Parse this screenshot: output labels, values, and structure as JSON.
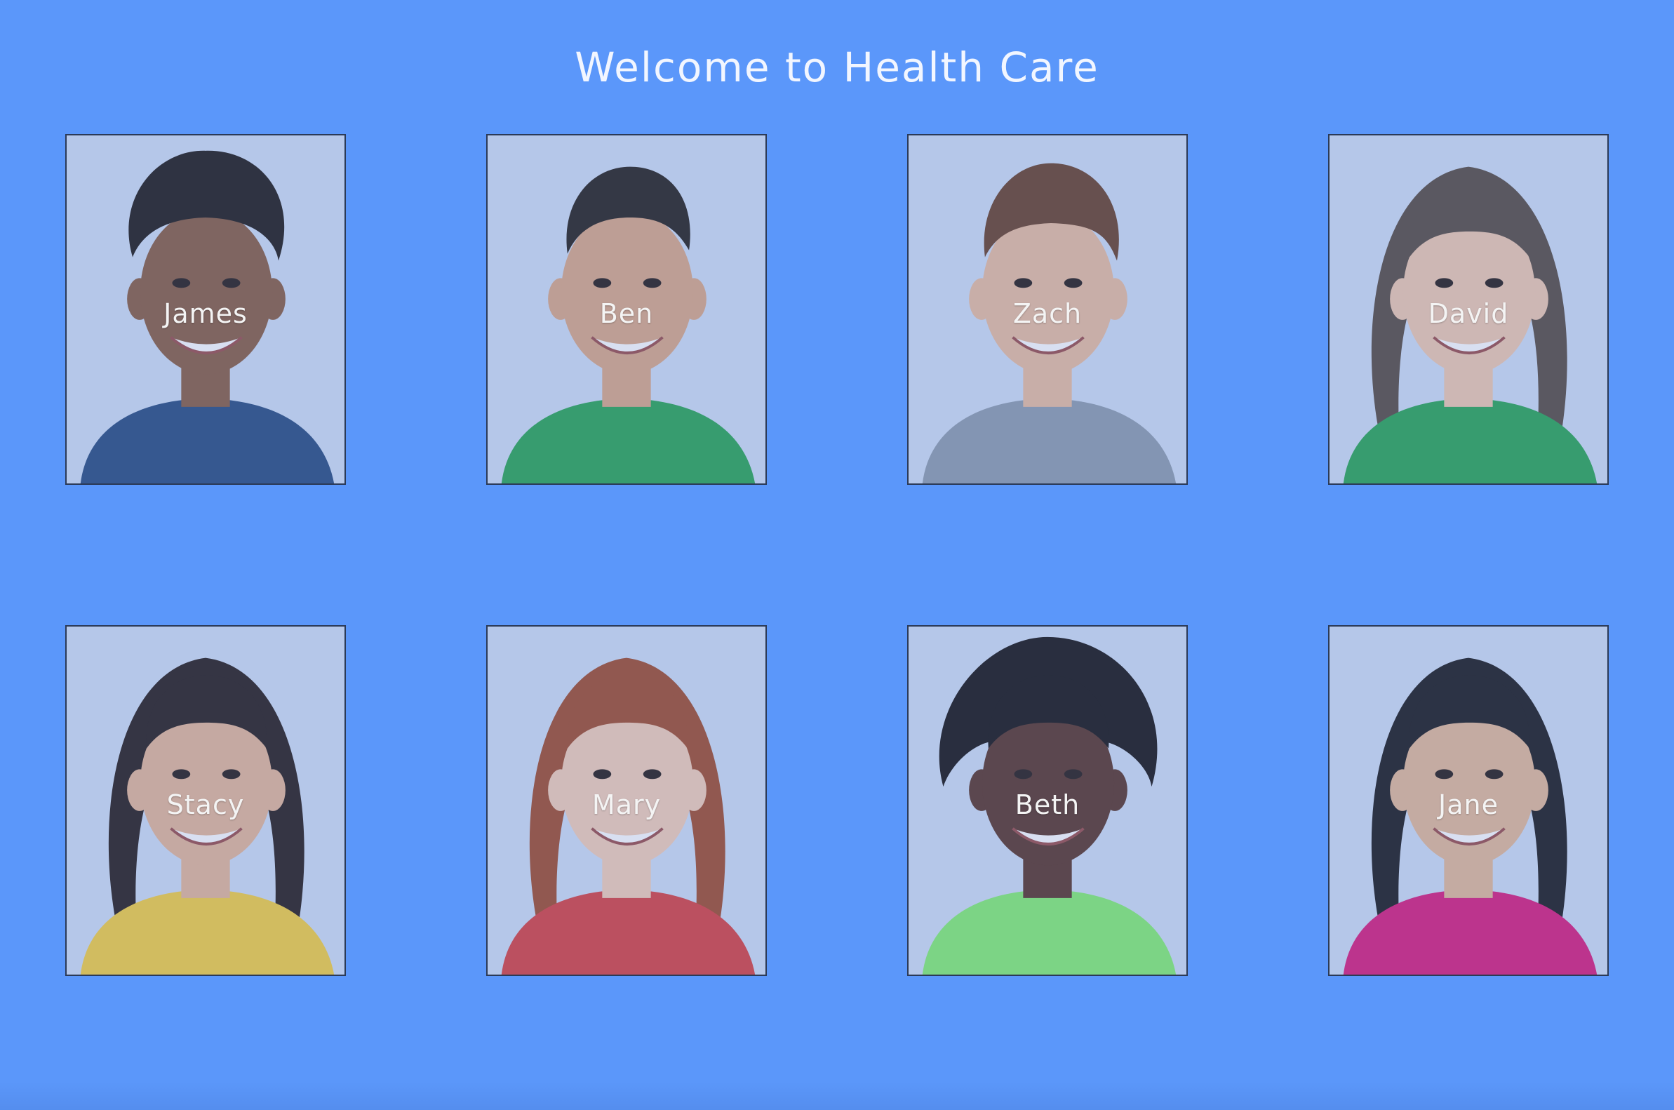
{
  "header": {
    "title": "Welcome to Health Care"
  },
  "patients": [
    {
      "name": "James",
      "skin": "#8a5a3c",
      "hair": "#231a14",
      "shirt": "#2c4a78",
      "hair_style": "curly"
    },
    {
      "name": "Ben",
      "skin": "#d9a37e",
      "hair": "#2a2018",
      "shirt": "#2ea04d",
      "hair_style": "short"
    },
    {
      "name": "Zach",
      "skin": "#e7b897",
      "hair": "#6b3f24",
      "shirt": "#8f98a4",
      "hair_style": "bowl"
    },
    {
      "name": "David",
      "skin": "#edc3a6",
      "hair": "#5a4a3c",
      "shirt": "#2ea04d",
      "hair_style": "long"
    },
    {
      "name": "Stacy",
      "skin": "#e3b18f",
      "hair": "#2b1d16",
      "shirt": "#f2c93a",
      "hair_style": "long"
    },
    {
      "name": "Mary",
      "skin": "#f1c8ae",
      "hair": "#a04a26",
      "shirt": "#d63f3a",
      "hair_style": "long"
    },
    {
      "name": "Beth",
      "skin": "#5b3424",
      "hair": "#1b1410",
      "shirt": "#86e86a",
      "hair_style": "afro"
    },
    {
      "name": "Jane",
      "skin": "#e2b48f",
      "hair": "#1f1a18",
      "shirt": "#d81b74",
      "hair_style": "long"
    }
  ]
}
